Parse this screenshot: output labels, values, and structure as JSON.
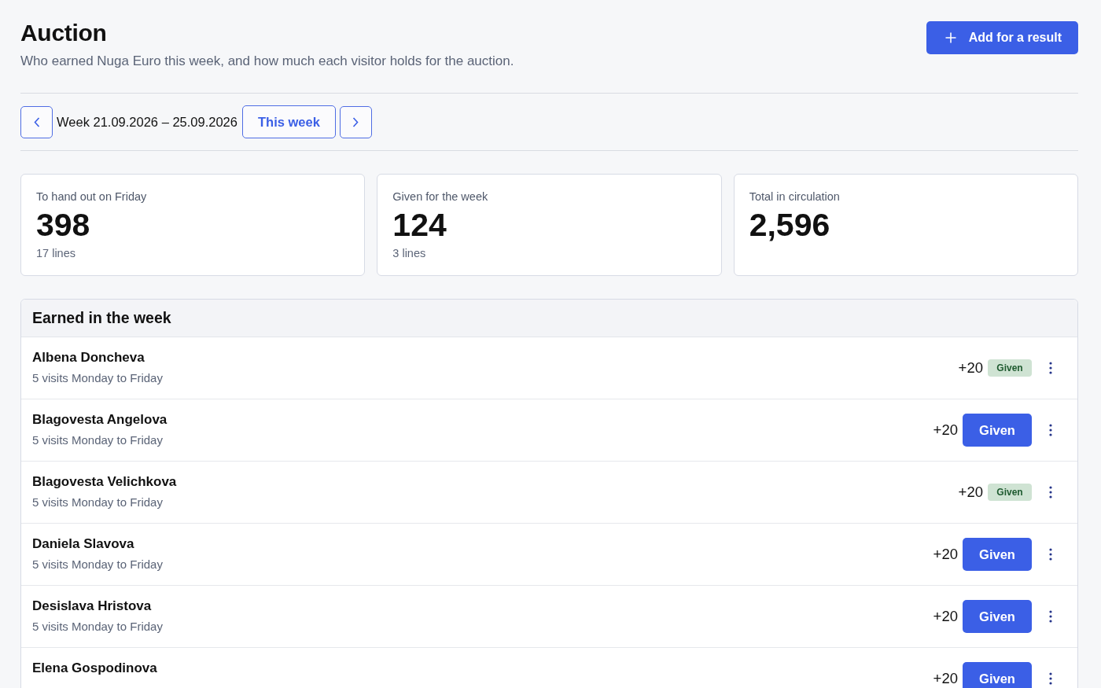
{
  "header": {
    "title": "Auction",
    "subtitle": "Who earned Nuga Euro this week, and how much each visitor holds for the auction.",
    "add_button": "Add for a result"
  },
  "week_nav": {
    "label": "Week 21.09.2026 – 25.09.2026",
    "current_button": "This week"
  },
  "stats": [
    {
      "label": "To hand out on Friday",
      "value": "398",
      "detail": "17 lines"
    },
    {
      "label": "Given for the week",
      "value": "124",
      "detail": "3 lines"
    },
    {
      "label": "Total in circulation",
      "value": "2,596"
    }
  ],
  "earned": {
    "title": "Earned in the week",
    "rows": [
      {
        "name": "Albena Doncheva",
        "detail": "5 visits Monday to Friday",
        "amount": "+20",
        "status": "Given",
        "given": true
      },
      {
        "name": "Blagovesta Angelova",
        "detail": "5 visits Monday to Friday",
        "amount": "+20",
        "status": "Given",
        "given": false
      },
      {
        "name": "Blagovesta Velichkova",
        "detail": "5 visits Monday to Friday",
        "amount": "+20",
        "status": "Given",
        "given": true
      },
      {
        "name": "Daniela Slavova",
        "detail": "5 visits Monday to Friday",
        "amount": "+20",
        "status": "Given",
        "given": false
      },
      {
        "name": "Desislava Hristova",
        "detail": "5 visits Monday to Friday",
        "amount": "+20",
        "status": "Given",
        "given": false
      },
      {
        "name": "Elena Gospodinova",
        "amount": "+20",
        "status": "Given",
        "given": false
      }
    ]
  }
}
